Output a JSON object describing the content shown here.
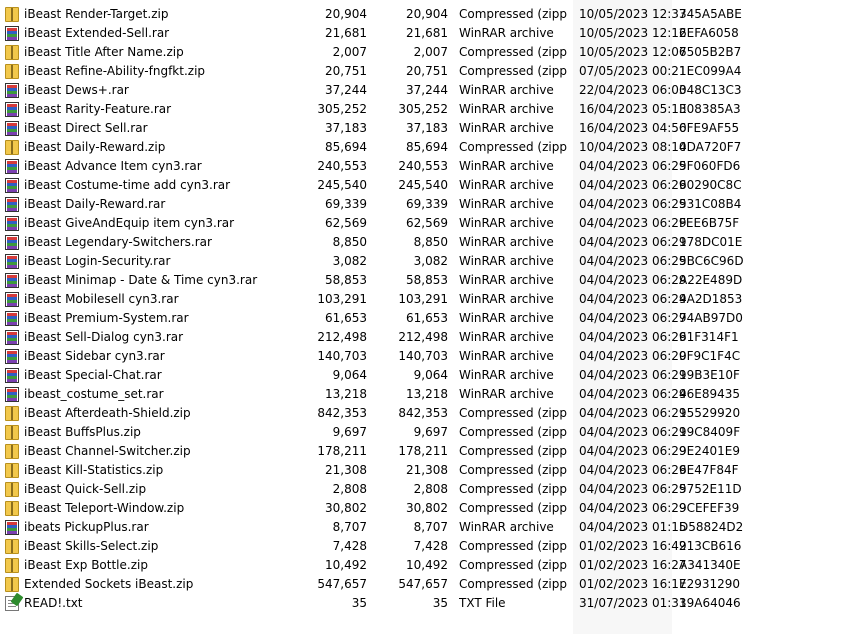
{
  "files": [
    {
      "name": "iBeast Render-Target.zip",
      "size": "20,904",
      "packed": "20,904",
      "type": "Compressed (zipp...",
      "modified": "10/05/2023 12:37",
      "crc": "345A5ABE",
      "icon": "zip-icon"
    },
    {
      "name": "iBeast Extended-Sell.rar",
      "size": "21,681",
      "packed": "21,681",
      "type": "WinRAR archive",
      "modified": "10/05/2023 12:12",
      "crc": "6EFA6058",
      "icon": "rar-icon"
    },
    {
      "name": "iBeast Title After Name.zip",
      "size": "2,007",
      "packed": "2,007",
      "type": "Compressed (zipp...",
      "modified": "10/05/2023 12:06",
      "crc": "7505B2B7",
      "icon": "zip-icon"
    },
    {
      "name": "iBeast Refine-Ability-fngfkt.zip",
      "size": "20,751",
      "packed": "20,751",
      "type": "Compressed (zipp...",
      "modified": "07/05/2023 00:21",
      "crc": "1EC099A4",
      "icon": "zip-icon"
    },
    {
      "name": "iBeast Dews+.rar",
      "size": "37,244",
      "packed": "37,244",
      "type": "WinRAR archive",
      "modified": "22/04/2023 06:03",
      "crc": "048C13C3",
      "icon": "rar-icon"
    },
    {
      "name": "iBeast Rarity-Feature.rar",
      "size": "305,252",
      "packed": "305,252",
      "type": "WinRAR archive",
      "modified": "16/04/2023 05:13",
      "crc": "E08385A3",
      "icon": "rar-icon"
    },
    {
      "name": "iBeast Direct Sell.rar",
      "size": "37,183",
      "packed": "37,183",
      "type": "WinRAR archive",
      "modified": "16/04/2023 04:56",
      "crc": "0FE9AF55",
      "icon": "rar-icon"
    },
    {
      "name": "iBeast Daily-Reward.zip",
      "size": "85,694",
      "packed": "85,694",
      "type": "Compressed (zipp...",
      "modified": "10/04/2023 08:10",
      "crc": "4DA720F7",
      "icon": "zip-icon"
    },
    {
      "name": "iBeast Advance Item cyn3.rar",
      "size": "240,553",
      "packed": "240,553",
      "type": "WinRAR archive",
      "modified": "04/04/2023 06:29",
      "crc": "5F060FD6",
      "icon": "rar-icon"
    },
    {
      "name": "iBeast Costume-time add cyn3.rar",
      "size": "245,540",
      "packed": "245,540",
      "type": "WinRAR archive",
      "modified": "04/04/2023 06:29",
      "crc": "60290C8C",
      "icon": "rar-icon"
    },
    {
      "name": "iBeast Daily-Reward.rar",
      "size": "69,339",
      "packed": "69,339",
      "type": "WinRAR archive",
      "modified": "04/04/2023 06:29",
      "crc": "531C08B4",
      "icon": "rar-icon"
    },
    {
      "name": "iBeast GiveAndEquip item cyn3.rar",
      "size": "62,569",
      "packed": "62,569",
      "type": "WinRAR archive",
      "modified": "04/04/2023 06:29",
      "crc": "FEE6B75F",
      "icon": "rar-icon"
    },
    {
      "name": "iBeast Legendary-Switchers.rar",
      "size": "8,850",
      "packed": "8,850",
      "type": "WinRAR archive",
      "modified": "04/04/2023 06:29",
      "crc": "178DC01E",
      "icon": "rar-icon"
    },
    {
      "name": "iBeast Login-Security.rar",
      "size": "3,082",
      "packed": "3,082",
      "type": "WinRAR archive",
      "modified": "04/04/2023 06:29",
      "crc": "5BC6C96D",
      "icon": "rar-icon"
    },
    {
      "name": "iBeast Minimap - Date & Time cyn3.rar",
      "size": "58,853",
      "packed": "58,853",
      "type": "WinRAR archive",
      "modified": "04/04/2023 06:29",
      "crc": "A22E489D",
      "icon": "rar-icon"
    },
    {
      "name": "iBeast Mobilesell cyn3.rar",
      "size": "103,291",
      "packed": "103,291",
      "type": "WinRAR archive",
      "modified": "04/04/2023 06:29",
      "crc": "4A2D1853",
      "icon": "rar-icon"
    },
    {
      "name": "iBeast Premium-System.rar",
      "size": "61,653",
      "packed": "61,653",
      "type": "WinRAR archive",
      "modified": "04/04/2023 06:29",
      "crc": "74AB97D0",
      "icon": "rar-icon"
    },
    {
      "name": "iBeast Sell-Dialog cyn3.rar",
      "size": "212,498",
      "packed": "212,498",
      "type": "WinRAR archive",
      "modified": "04/04/2023 06:29",
      "crc": "61F314F1",
      "icon": "rar-icon"
    },
    {
      "name": "iBeast Sidebar cyn3.rar",
      "size": "140,703",
      "packed": "140,703",
      "type": "WinRAR archive",
      "modified": "04/04/2023 06:29",
      "crc": "0F9C1F4C",
      "icon": "rar-icon"
    },
    {
      "name": "iBeast Special-Chat.rar",
      "size": "9,064",
      "packed": "9,064",
      "type": "WinRAR archive",
      "modified": "04/04/2023 06:29",
      "crc": "19B3E10F",
      "icon": "rar-icon"
    },
    {
      "name": "ibeast_costume_set.rar",
      "size": "13,218",
      "packed": "13,218",
      "type": "WinRAR archive",
      "modified": "04/04/2023 06:29",
      "crc": "46E89435",
      "icon": "rar-icon"
    },
    {
      "name": "iBeast Afterdeath-Shield.zip",
      "size": "842,353",
      "packed": "842,353",
      "type": "Compressed (zipp...",
      "modified": "04/04/2023 06:29",
      "crc": "15529920",
      "icon": "zip-icon"
    },
    {
      "name": "iBeast BuffsPlus.zip",
      "size": "9,697",
      "packed": "9,697",
      "type": "Compressed (zipp...",
      "modified": "04/04/2023 06:29",
      "crc": "19C8409F",
      "icon": "zip-icon"
    },
    {
      "name": "iBeast Channel-Switcher.zip",
      "size": "178,211",
      "packed": "178,211",
      "type": "Compressed (zipp...",
      "modified": "04/04/2023 06:29",
      "crc": "9E2401E9",
      "icon": "zip-icon"
    },
    {
      "name": "iBeast Kill-Statistics.zip",
      "size": "21,308",
      "packed": "21,308",
      "type": "Compressed (zipp...",
      "modified": "04/04/2023 06:29",
      "crc": "6E47F84F",
      "icon": "zip-icon"
    },
    {
      "name": "iBeast Quick-Sell.zip",
      "size": "2,808",
      "packed": "2,808",
      "type": "Compressed (zipp...",
      "modified": "04/04/2023 06:29",
      "crc": "5752E11D",
      "icon": "zip-icon"
    },
    {
      "name": "iBeast Teleport-Window.zip",
      "size": "30,802",
      "packed": "30,802",
      "type": "Compressed (zipp...",
      "modified": "04/04/2023 06:29",
      "crc": "9CEFEF39",
      "icon": "zip-icon"
    },
    {
      "name": "ibeats PickupPlus.rar",
      "size": "8,707",
      "packed": "8,707",
      "type": "WinRAR archive",
      "modified": "04/04/2023 01:15",
      "crc": "D58824D2",
      "icon": "rar-icon"
    },
    {
      "name": "iBeast Skills-Select.zip",
      "size": "7,428",
      "packed": "7,428",
      "type": "Compressed (zipp...",
      "modified": "01/02/2023 16:42",
      "crc": "913CB616",
      "icon": "zip-icon"
    },
    {
      "name": "iBeast Exp Bottle.zip",
      "size": "10,492",
      "packed": "10,492",
      "type": "Compressed (zipp...",
      "modified": "01/02/2023 16:27",
      "crc": "A341340E",
      "icon": "zip-icon"
    },
    {
      "name": "Extended Sockets iBeast.zip",
      "size": "547,657",
      "packed": "547,657",
      "type": "Compressed (zipp...",
      "modified": "01/02/2023 16:17",
      "crc": "E2931290",
      "icon": "zip-icon"
    },
    {
      "name": "READ!.txt",
      "size": "35",
      "packed": "35",
      "type": "TXT File",
      "modified": "31/07/2023 01:33",
      "crc": "19A64046",
      "icon": "txt-icon"
    }
  ],
  "colors": {
    "sorted_column_bg": "#f7f7f7",
    "background": "#ffffff",
    "text": "#000000"
  }
}
